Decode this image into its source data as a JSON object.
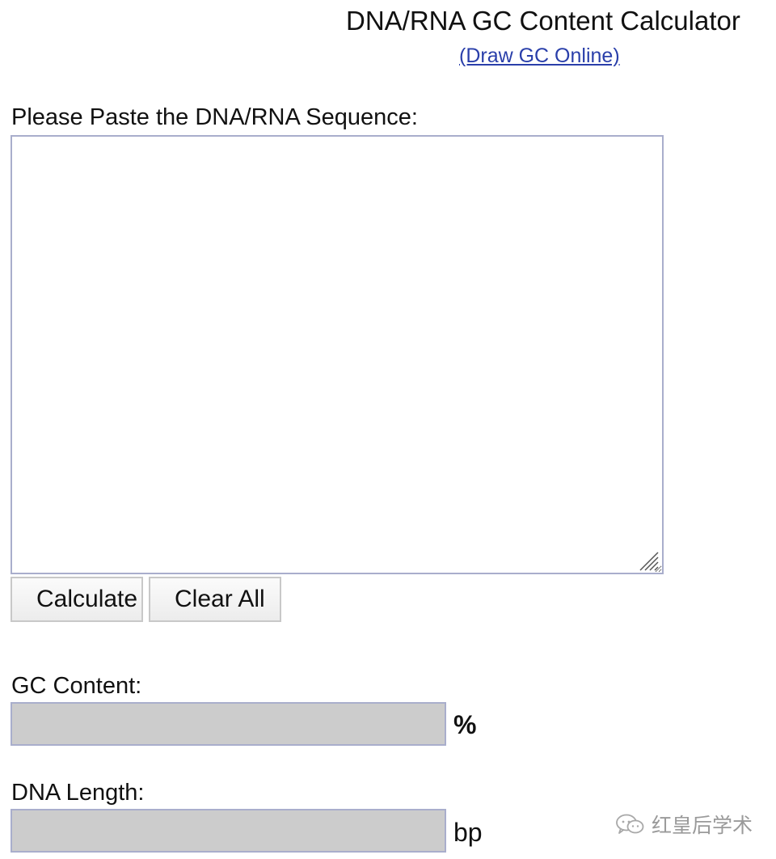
{
  "header": {
    "title": "DNA/RNA GC Content Calculator",
    "draw_link": "(Draw GC Online)"
  },
  "sequence": {
    "label": "Please Paste the DNA/RNA Sequence:",
    "value": ""
  },
  "buttons": {
    "calculate": "Calculate",
    "clear_all": "Clear All"
  },
  "gc_content": {
    "label": "GC Content:",
    "value": "",
    "unit": "%"
  },
  "dna_length": {
    "label": "DNA Length:",
    "value": "",
    "unit": "bp"
  },
  "watermark": {
    "text": "红皇后学术",
    "icon": "wechat-icon"
  },
  "colors": {
    "link": "#2a3faa",
    "field_border": "#a9aecc",
    "result_bg": "#cccccc",
    "text": "#111111",
    "watermark": "#9a9a9a"
  }
}
